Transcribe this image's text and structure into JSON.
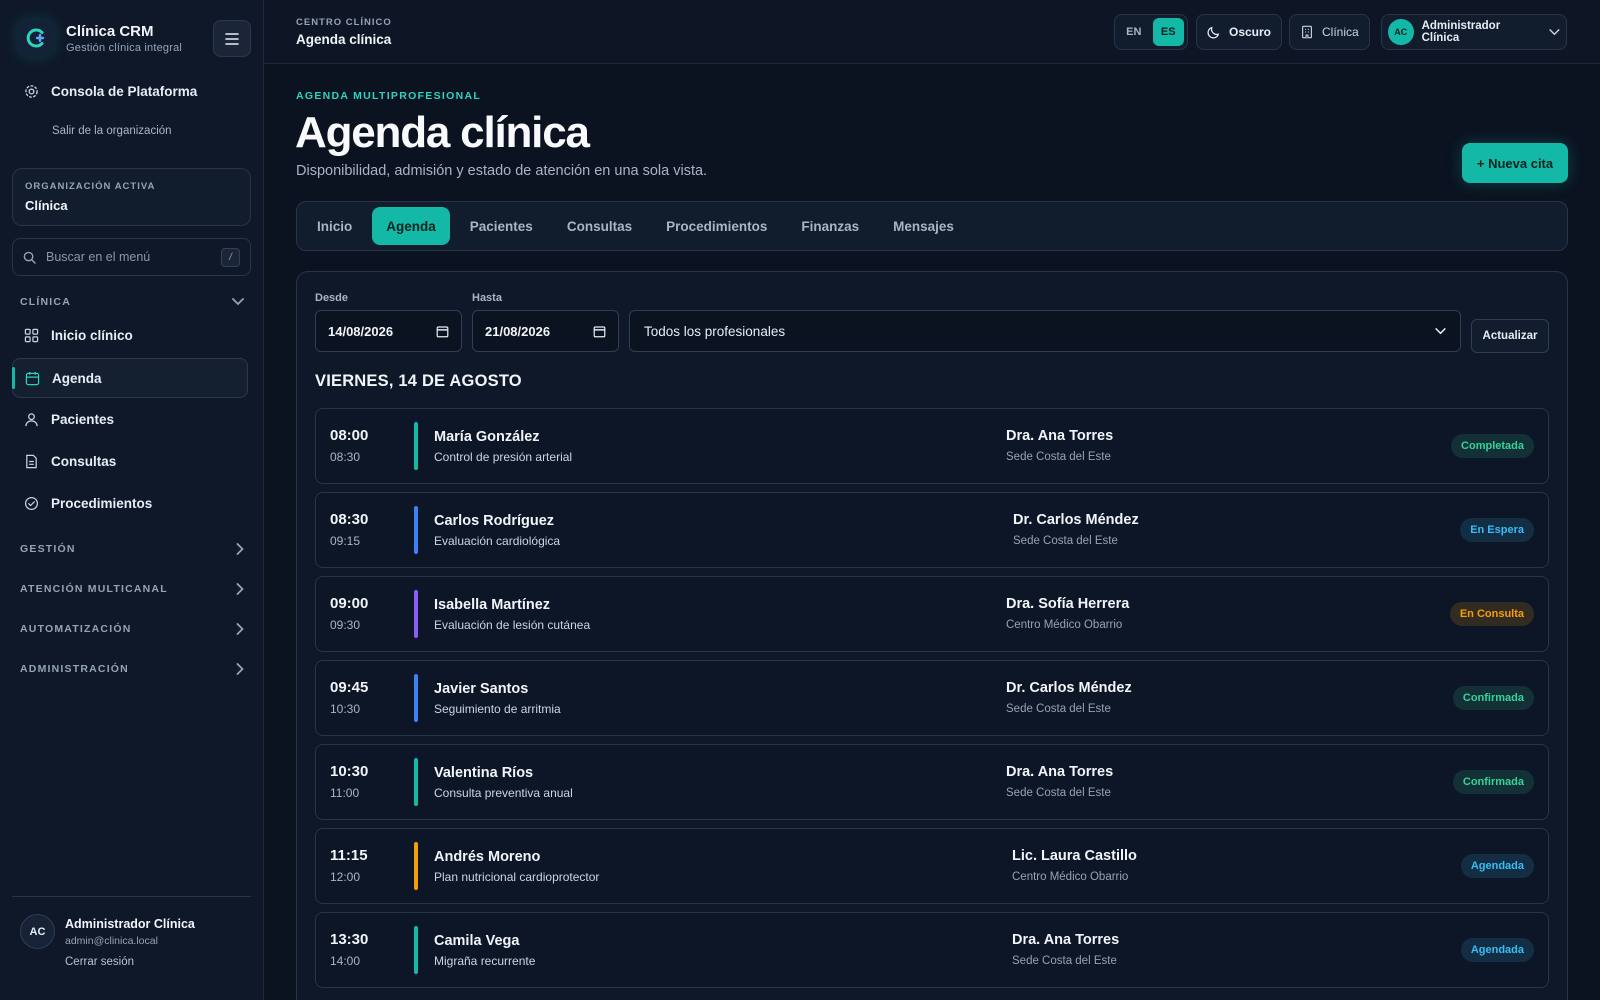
{
  "colors": {
    "accent": "#14b8a6",
    "completada": "#34d399",
    "en_espera": "#38bdf8",
    "en_consulta": "#f59e0b",
    "confirmada": "#34d399",
    "agendada": "#38bdf8"
  },
  "sidebar": {
    "brand_name": "Clínica CRM",
    "brand_sub": "Gestión clínica integral",
    "platform_label": "Consola de Plataforma",
    "leave_org": "Salir de la organización",
    "org_label": "ORGANIZACIÓN ACTIVA",
    "org_value": "Clínica",
    "search_placeholder": "Buscar en el menú",
    "search_shortcut": "/",
    "section_clinica": "CLÍNICA",
    "items": [
      {
        "label": "Inicio clínico",
        "icon": "grid-icon"
      },
      {
        "label": "Agenda",
        "icon": "calendar-icon"
      },
      {
        "label": "Pacientes",
        "icon": "user-icon"
      },
      {
        "label": "Consultas",
        "icon": "document-icon"
      },
      {
        "label": "Procedimientos",
        "icon": "check-circle-icon"
      }
    ],
    "sections": [
      "GESTIÓN",
      "ATENCIÓN MULTICANAL",
      "AUTOMATIZACIÓN",
      "ADMINISTRACIÓN"
    ],
    "user": {
      "initials": "AC",
      "name": "Administrador Clínica",
      "email": "admin@clinica.local",
      "logout": "Cerrar sesión"
    }
  },
  "topbar": {
    "eyebrow": "CENTRO CLÍNICO",
    "title": "Agenda clínica",
    "lang_en": "EN",
    "lang_es": "ES",
    "theme": "Oscuro",
    "org": "Clínica",
    "user_initials": "AC",
    "user_name": "Administrador Clínica"
  },
  "main": {
    "eyebrow": "AGENDA MULTIPROFESIONAL",
    "title": "Agenda clínica",
    "subtitle": "Disponibilidad, admisión y estado de atención en una sola vista.",
    "new_button": "+ Nueva cita",
    "tabs": [
      "Inicio",
      "Agenda",
      "Pacientes",
      "Consultas",
      "Procedimientos",
      "Finanzas",
      "Mensajes"
    ],
    "filters": {
      "from_label": "Desde",
      "from_value": "14/08/2026",
      "to_label": "Hasta",
      "to_value": "21/08/2026",
      "professional": "Todos los profesionales",
      "refresh": "Actualizar"
    },
    "day_heading": "VIERNES, 14 DE AGOSTO",
    "appointments": [
      {
        "start": "08:00",
        "end": "08:30",
        "patient": "María González",
        "reason": "Control de presión arterial",
        "doctor": "Dra. Ana Torres",
        "site": "Sede Costa del Este",
        "status": "Completada",
        "bar": "#14b8a6"
      },
      {
        "start": "08:30",
        "end": "09:15",
        "patient": "Carlos Rodríguez",
        "reason": "Evaluación cardiológica",
        "doctor": "Dr. Carlos Méndez",
        "site": "Sede Costa del Este",
        "status": "En Espera",
        "bar": "#3b82f6"
      },
      {
        "start": "09:00",
        "end": "09:30",
        "patient": "Isabella Martínez",
        "reason": "Evaluación de lesión cutánea",
        "doctor": "Dra. Sofía Herrera",
        "site": "Centro Médico Obarrio",
        "status": "En Consulta",
        "bar": "#8b5cf6"
      },
      {
        "start": "09:45",
        "end": "10:30",
        "patient": "Javier Santos",
        "reason": "Seguimiento de arritmia",
        "doctor": "Dr. Carlos Méndez",
        "site": "Sede Costa del Este",
        "status": "Confirmada",
        "bar": "#3b82f6"
      },
      {
        "start": "10:30",
        "end": "11:00",
        "patient": "Valentina Ríos",
        "reason": "Consulta preventiva anual",
        "doctor": "Dra. Ana Torres",
        "site": "Sede Costa del Este",
        "status": "Confirmada",
        "bar": "#14b8a6"
      },
      {
        "start": "11:15",
        "end": "12:00",
        "patient": "Andrés Moreno",
        "reason": "Plan nutricional cardioprotector",
        "doctor": "Lic. Laura Castillo",
        "site": "Centro Médico Obarrio",
        "status": "Agendada",
        "bar": "#f59e0b"
      },
      {
        "start": "13:30",
        "end": "14:00",
        "patient": "Camila Vega",
        "reason": "Migraña recurrente",
        "doctor": "Dra. Ana Torres",
        "site": "Sede Costa del Este",
        "status": "Agendada",
        "bar": "#14b8a6"
      }
    ]
  }
}
